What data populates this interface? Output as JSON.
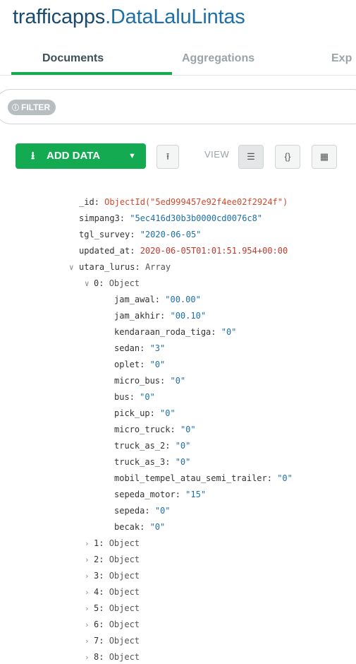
{
  "header": {
    "db_name": "trafficapps",
    "collection_suffix": ".DataLaluLintas"
  },
  "tabs": [
    {
      "label": "Documents"
    },
    {
      "label": "Aggregations"
    },
    {
      "label": "Exp"
    }
  ],
  "filter": {
    "label": "FILTER"
  },
  "toolbar": {
    "add_data_label": "ADD DATA",
    "view_label": "VIEW"
  },
  "document": {
    "fields": [
      {
        "key": "_id",
        "value": "ObjectId(\"5ed999457e92f4ee02f2924f\")"
      },
      {
        "key": "simpang3",
        "value": "\"5ec416d30b3b0000cd0076c8\""
      },
      {
        "key": "tgl_survey",
        "value": "\"2020-06-05\""
      },
      {
        "key": "updated_at",
        "value": "2020-06-05T01:01:51.954+00:00"
      }
    ],
    "array_field": {
      "key": "utara_lurus",
      "type": "Array"
    },
    "expanded_item": {
      "key": "0",
      "type": "Object",
      "fields": [
        {
          "key": "jam_awal",
          "value": "\"00.00\""
        },
        {
          "key": "jam_akhir",
          "value": "\"00.10\""
        },
        {
          "key": "kendaraan_roda_tiga",
          "value": "\"0\""
        },
        {
          "key": "sedan",
          "value": "\"3\""
        },
        {
          "key": "oplet",
          "value": "\"0\""
        },
        {
          "key": "micro_bus",
          "value": "\"0\""
        },
        {
          "key": "bus",
          "value": "\"0\""
        },
        {
          "key": "pick_up",
          "value": "\"0\""
        },
        {
          "key": "micro_truck",
          "value": "\"0\""
        },
        {
          "key": "truck_as_2",
          "value": "\"0\""
        },
        {
          "key": "truck_as_3",
          "value": "\"0\""
        },
        {
          "key": "mobil_tempel_atau_semi_trailer",
          "value": "\"0\""
        },
        {
          "key": "sepeda_motor",
          "value": "\"15\""
        },
        {
          "key": "sepeda",
          "value": "\"0\""
        },
        {
          "key": "becak",
          "value": "\"0\""
        }
      ]
    },
    "collapsed_items": [
      {
        "key": "1",
        "type": "Object"
      },
      {
        "key": "2",
        "type": "Object"
      },
      {
        "key": "3",
        "type": "Object"
      },
      {
        "key": "4",
        "type": "Object"
      },
      {
        "key": "5",
        "type": "Object"
      },
      {
        "key": "6",
        "type": "Object"
      },
      {
        "key": "7",
        "type": "Object"
      },
      {
        "key": "8",
        "type": "Object"
      }
    ]
  }
}
